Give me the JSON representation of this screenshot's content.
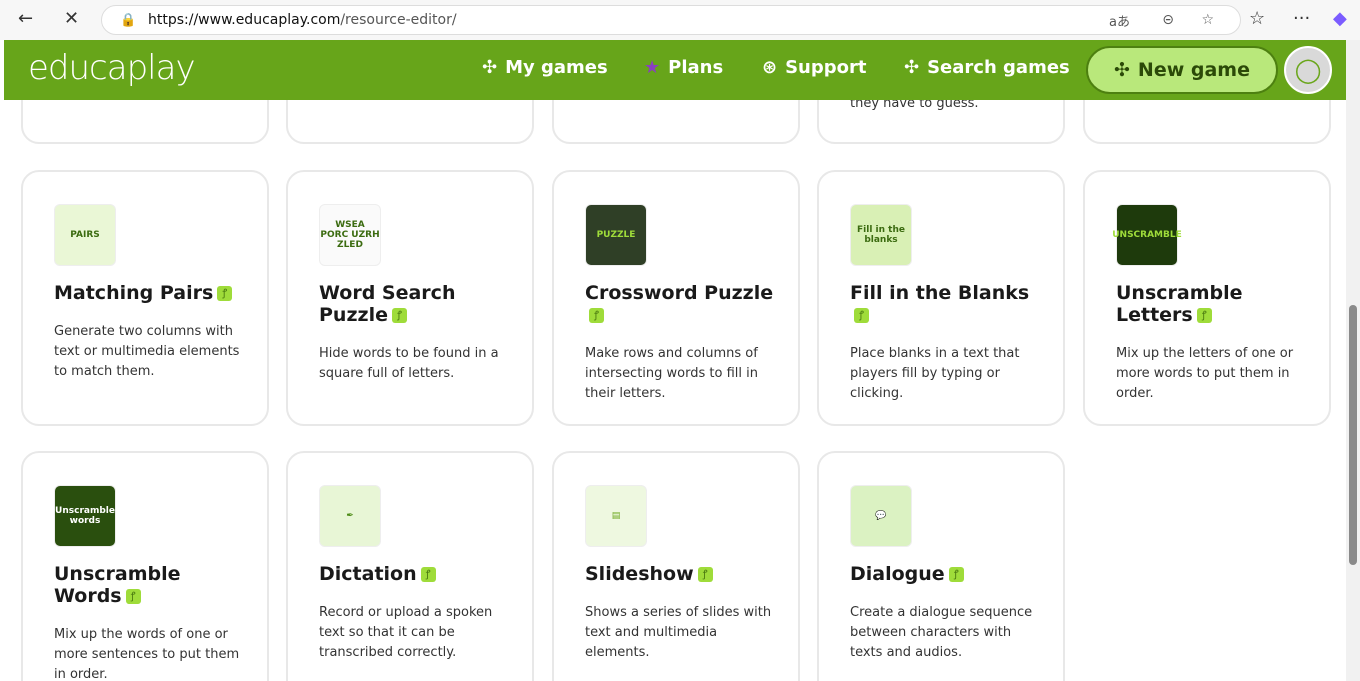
{
  "browser": {
    "url_host": "https://www.educaplay.com",
    "url_path": "/resource-editor/"
  },
  "header": {
    "logo": "educaplay",
    "nav": [
      {
        "label": "My games",
        "icon": "puzzle-icon"
      },
      {
        "label": "Plans",
        "icon": "star-icon"
      },
      {
        "label": "Support",
        "icon": "lifebuoy-icon"
      },
      {
        "label": "Search games",
        "icon": "search-puzzle-icon"
      }
    ],
    "new_game": "New game"
  },
  "top_partial_text": "they have to guess.",
  "badge": "ꝭ",
  "cards": [
    {
      "title": "Matching Pairs",
      "desc": "Generate two columns with text or multimedia elements to match them.",
      "icon_text": "PAIRS"
    },
    {
      "title": "Word Search Puzzle",
      "desc": "Hide words to be found in a square full of letters.",
      "icon_text": "WSEA PORC UZRH ZLED"
    },
    {
      "title": "Crossword Puzzle",
      "desc": "Make rows and columns of intersecting words to fill in their letters.",
      "icon_text": "PUZZLE"
    },
    {
      "title": "Fill in the Blanks",
      "desc": "Place blanks in a text that players fill by typing or clicking.",
      "icon_text": "Fill in the blanks"
    },
    {
      "title": "Unscramble Letters",
      "desc": "Mix up the letters of one or more words to put them in order.",
      "icon_text": "UNSCRAMBLE"
    },
    {
      "title": "Unscramble Words",
      "desc": "Mix up the words of one or more sentences to put them in order.",
      "icon_text": "Unscramble words"
    },
    {
      "title": "Dictation",
      "desc": "Record or upload a spoken text so that it can be transcribed correctly.",
      "icon_text": "✒"
    },
    {
      "title": "Slideshow",
      "desc": "Shows a series of slides with text and multimedia elements.",
      "icon_text": "▤"
    },
    {
      "title": "Dialogue",
      "desc": "Create a dialogue sequence between characters with texts and audios.",
      "icon_text": "💬"
    }
  ]
}
